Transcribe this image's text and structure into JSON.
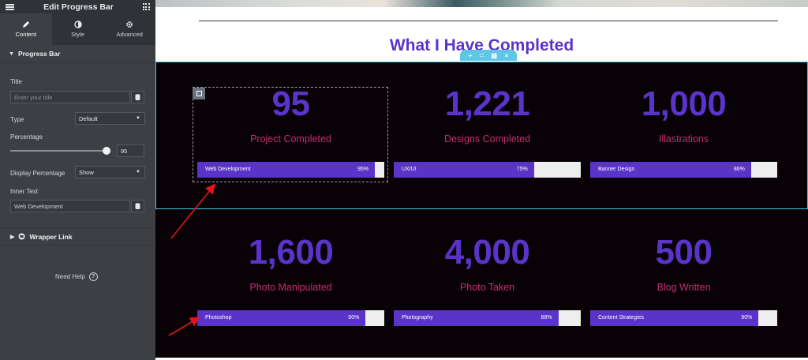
{
  "editor": {
    "title": "Edit Progress Bar",
    "tabs": [
      {
        "label": "Content",
        "icon": "pencil-icon"
      },
      {
        "label": "Style",
        "icon": "half-circle-icon"
      },
      {
        "label": "Advanced",
        "icon": "gear-icon"
      }
    ],
    "section_title": "Progress Bar",
    "title_label": "Title",
    "title_placeholder": "Enter your title",
    "type_label": "Type",
    "type_value": "Default",
    "percentage_label": "Percentage",
    "percentage_value": "95",
    "display_percentage_label": "Display Percentage",
    "display_percentage_value": "Show",
    "inner_text_label": "Inner Text",
    "inner_text_value": "Web Development",
    "wrapper_link_label": "Wrapper Link",
    "need_help_label": "Need Help",
    "help_glyph": "?"
  },
  "page": {
    "heading": "What I Have Completed",
    "toolbar_icons": [
      "plus-icon",
      "drag-icon",
      "copy-icon",
      "close-icon"
    ],
    "toolbar_glyphs": [
      "+",
      "∷",
      "▧",
      "×"
    ]
  },
  "section1": [
    {
      "number": "95",
      "caption": "Project Completed",
      "bar_label": "Web Development",
      "bar_pct_text": "95%",
      "percent": 95
    },
    {
      "number": "1,221",
      "caption": "Designs Completed",
      "bar_label": "UX/UI",
      "bar_pct_text": "75%",
      "percent": 75
    },
    {
      "number": "1,000",
      "caption": "Illastrations",
      "bar_label": "Banner Design",
      "bar_pct_text": "86%",
      "percent": 86
    }
  ],
  "section2": [
    {
      "number": "1,600",
      "caption": "Photo Manipulated",
      "bar_label": "Photoshop",
      "bar_pct_text": "90%",
      "percent": 90
    },
    {
      "number": "4,000",
      "caption": "Photo Taken",
      "bar_label": "Photography",
      "bar_pct_text": "88%",
      "percent": 88
    },
    {
      "number": "500",
      "caption": "Blog Written",
      "bar_label": "Content Strategies",
      "bar_pct_text": "90%",
      "percent": 90
    }
  ],
  "colors": {
    "accent_purple": "#5a34c9",
    "caption_pink": "#c42f73",
    "section_bg": "#080106",
    "sidebar_bg": "#3c3f44",
    "selection_blue": "#4ac7e1",
    "annotation_arrow": "#e0141e"
  }
}
